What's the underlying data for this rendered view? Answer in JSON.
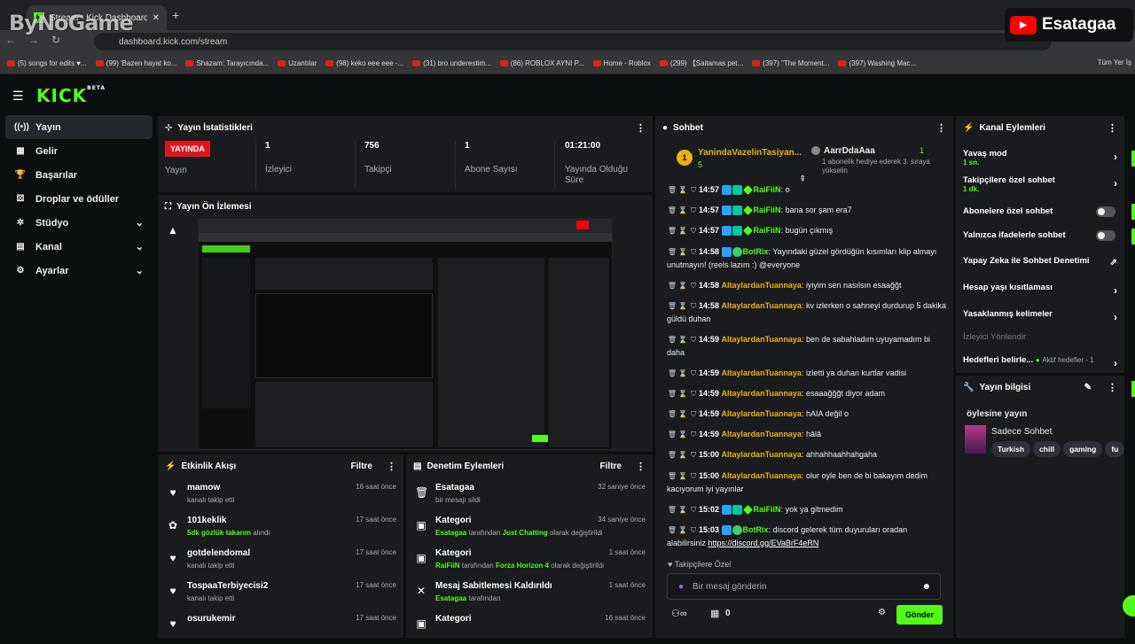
{
  "browser": {
    "tab_title": "Stream - Kick Dashboard",
    "url": "dashboard.kick.com/stream",
    "bookmarks": [
      "(5) songs for edits ♥...",
      "(99) 'Bazen hayat ko...",
      "Shazam: Tarayıcında...",
      "Uzantılar",
      "(98) keko eee eee -...",
      "(31) bro underestim...",
      "(86) ROBLOX AYNI P...",
      "Home - Roblox",
      "(299) 【Saitamas pet...",
      "(397) \"The Moment...",
      "(397) Washing Mac..."
    ],
    "bookmarks_folder": "Tüm Yer İş"
  },
  "watermarks": {
    "left": "ByNoGame",
    "right": "Esatagaa"
  },
  "logo": {
    "text": "KICK",
    "beta": "BETA"
  },
  "sidebar": [
    {
      "label": "Yayın",
      "icon": "broadcast-icon",
      "glyph": "((•))",
      "active": true
    },
    {
      "label": "Gelir",
      "icon": "revenue-icon",
      "glyph": "▦"
    },
    {
      "label": "Başarılar",
      "icon": "trophy-icon",
      "glyph": "🏆"
    },
    {
      "label": "Droplar ve ödüller",
      "icon": "gift-icon",
      "glyph": "⚄"
    },
    {
      "label": "Stüdyo",
      "icon": "studio-icon",
      "glyph": "✲",
      "chevron": true
    },
    {
      "label": "Kanal",
      "icon": "channel-icon",
      "glyph": "▤",
      "chevron": true
    },
    {
      "label": "Ayarlar",
      "icon": "gear-icon",
      "glyph": "⚙",
      "chevron": true
    }
  ],
  "stats": {
    "title": "Yayın İstatistikleri",
    "live_badge": "YAYINDA",
    "live_label": "Yayın",
    "items": [
      {
        "value": "1",
        "label": "İzleyici"
      },
      {
        "value": "756",
        "label": "Takipçi"
      },
      {
        "value": "1",
        "label": "Abone Sayısı"
      },
      {
        "value": "01:21:00",
        "label": "Yayında Olduğu Süre"
      }
    ]
  },
  "preview": {
    "title": "Yayın Ön İzlemesi"
  },
  "activity": {
    "title": "Etkinlik Akışı",
    "filter": "Filtre",
    "items": [
      {
        "icon": "heart-icon",
        "glyph": "♥",
        "name": "mamow",
        "sub": "kanalı takip etti",
        "time": "16 saat önce"
      },
      {
        "icon": "gift-icon",
        "glyph": "✿",
        "name": "101keklik",
        "sub_green": "5dk gözlük takarım",
        "sub": " alındı",
        "time": "17 saat önce"
      },
      {
        "icon": "heart-icon",
        "glyph": "♥",
        "name": "gotdelendomal",
        "sub": "kanalı takip etti",
        "time": "17 saat önce"
      },
      {
        "icon": "heart-icon",
        "glyph": "♥",
        "name": "TospaaTerbiyecisi2",
        "sub": "kanalı takip etti",
        "time": "17 saat önce"
      },
      {
        "icon": "heart-icon",
        "glyph": "♥",
        "name": "osurukemir",
        "sub": "",
        "time": "17 saat önce"
      }
    ]
  },
  "moderation": {
    "title": "Denetim Eylemleri",
    "filter": "Filtre",
    "items": [
      {
        "icon": "trash-icon",
        "glyph": "🗑",
        "name": "Esatagaa",
        "sub": "bir mesajı sildi",
        "time": "32 saniye önce"
      },
      {
        "icon": "category-icon",
        "glyph": "▣",
        "name": "Kategori",
        "sub_user": "Esatagaa",
        "sub_mid": " tarafından ",
        "sub_cat": "Just Chatting",
        "sub_end": " olarak değiştirildi",
        "time": "34 saniye önce"
      },
      {
        "icon": "category-icon",
        "glyph": "▣",
        "name": "Kategori",
        "sub_user": "RaiFiiN",
        "sub_mid": " tarafından ",
        "sub_cat": "Forza Horizon 4",
        "sub_end": " olarak değiştirildi",
        "time": "1 saat önce"
      },
      {
        "icon": "unpin-icon",
        "glyph": "✕",
        "name": "Mesaj Sabitlemesi Kaldırıldı",
        "sub_user": "Esatagaa",
        "sub_mid": " tarafından",
        "sub_cat": "",
        "sub_end": "",
        "time": "1 saat önce"
      },
      {
        "icon": "category-icon",
        "glyph": "▣",
        "name": "Kategori",
        "sub_user": "",
        "sub_mid": "",
        "sub_cat": "",
        "sub_end": "",
        "time": "16 saat önce"
      }
    ]
  },
  "chat": {
    "title": "Sohbet",
    "pinned": {
      "user": "YanindaVazelinTasiyan...",
      "level": "1",
      "count": "5",
      "gifter": "AarrDdaAaa",
      "gifter_count": "1",
      "gift_text": "1 abonelik hediye ederek 3. sıraya yükselin"
    },
    "messages": [
      {
        "time": "14:57",
        "user": "RaiFiiN",
        "ucls": "u-g",
        "badges": [
          "b",
          "c",
          "g"
        ],
        "text": "o"
      },
      {
        "time": "14:57",
        "user": "RaiFiiN",
        "ucls": "u-g",
        "badges": [
          "b",
          "c",
          "g"
        ],
        "text": "bana sor şam era7"
      },
      {
        "time": "14:57",
        "user": "RaiFiiN",
        "ucls": "u-g",
        "badges": [
          "b",
          "c",
          "g"
        ],
        "text": "bugün çıkmış"
      },
      {
        "time": "14:58",
        "user": "BotRix",
        "ucls": "u-g",
        "badges": [
          "b",
          "v"
        ],
        "text": "Yayındaki güzel gördüğün kısımları klip almayı unutmayın! (reels lazım :) @everyone"
      },
      {
        "time": "14:58",
        "user": "AltaylardanTuannaya",
        "ucls": "u-y",
        "badges": [],
        "text": "iyiyim sen nasılsın esaağğt"
      },
      {
        "time": "14:58",
        "user": "AltaylardanTuannaya",
        "ucls": "u-y",
        "badges": [],
        "text": "kv izlerken o sahneyi durdurup 5 dakika güldü duhan"
      },
      {
        "time": "14:59",
        "user": "AltaylardanTuannaya",
        "ucls": "u-y",
        "badges": [],
        "text": "ben de sabahladım uyuyamadım bi daha"
      },
      {
        "time": "14:59",
        "user": "AltaylardanTuannaya",
        "ucls": "u-y",
        "badges": [],
        "text": "izletti ya duhan kurtlar vadisi"
      },
      {
        "time": "14:59",
        "user": "AltaylardanTuannaya",
        "ucls": "u-y",
        "badges": [],
        "text": "esaaağğğt diyor adam"
      },
      {
        "time": "14:59",
        "user": "AltaylardanTuannaya",
        "ucls": "u-y",
        "badges": [],
        "text": "hAIA değil o"
      },
      {
        "time": "14:59",
        "user": "AltaylardanTuannaya",
        "ucls": "u-y",
        "badges": [],
        "text": "hâlâ"
      },
      {
        "time": "15:00",
        "user": "AltaylardanTuannaya",
        "ucls": "u-y",
        "badges": [],
        "text": "ahhahhaahhahgaha"
      },
      {
        "time": "15:00",
        "user": "AltaylardanTuannaya",
        "ucls": "u-y",
        "badges": [],
        "text": "olur oyle ben de bi bakayım dedim kacıyorum iyi yayınlar"
      },
      {
        "time": "15:02",
        "user": "RaiFiiN",
        "ucls": "u-g",
        "badges": [
          "b",
          "c",
          "g"
        ],
        "text": "yok ya gitmedim"
      },
      {
        "time": "15:03",
        "user": "BotRix",
        "ucls": "u-g",
        "badges": [
          "b",
          "v"
        ],
        "text": "discord gelerek tüm duyuruları oradan alabilirsiniz ",
        "link": "https://discord.gg/EVaBrF4eRN"
      }
    ],
    "followers_only": "Takipçilere Özel",
    "input_placeholder": "Bir mesaj gönderin",
    "points": "0",
    "send": "Gönder"
  },
  "actions": {
    "title": "Kanal Eylemleri",
    "slow_mode": "Yavaş mod",
    "slow_mode_value": "1 sn.",
    "followers_chat": "Takipçilere özel sohbet",
    "followers_chat_value": "1 dk.",
    "subs_chat": "Abonelere özel sohbet",
    "emote_chat": "Yalnızca ifadelerle sohbet",
    "ai_moderation": "Yapay Zeka ile Sohbet Denetimi",
    "account_age": "Hesap yaşı kısıtlaması",
    "banned_words": "Yasaklanmış kelimeler",
    "viewer_redirect": "İzleyici Yönlendir",
    "goals": "Hedefleri belirle...",
    "goals_status": "Aktif hedefler - 1"
  },
  "stream_info": {
    "title": "Yayın bilgisi",
    "stream_title": "öylesine yayın",
    "category": "Sadece Sohbet",
    "tags": [
      "Turkish",
      "chill",
      "gaming",
      "fu"
    ]
  },
  "colors": {
    "accent": "#53fc18",
    "live": "#e0141e",
    "panel": "#191b1f",
    "bg": "#0b0e0f",
    "gold": "#e9b019"
  }
}
